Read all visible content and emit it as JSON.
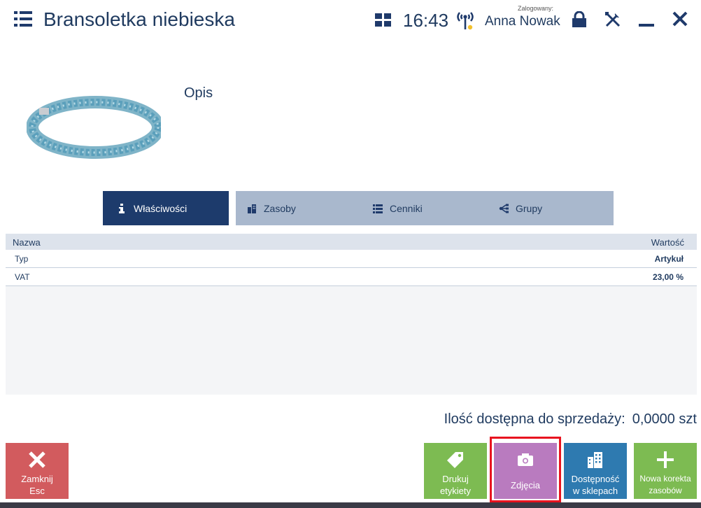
{
  "header": {
    "title": "Bransoletka niebieska",
    "time": "16:43",
    "logged_label": "Zalogowany:",
    "user": "Anna Nowak"
  },
  "product": {
    "description_label": "Opis",
    "image_icon": "bracelet-photo"
  },
  "tabs": [
    {
      "label": "Właściwości",
      "icon": "info-icon",
      "active": true
    },
    {
      "label": "Zasoby",
      "icon": "building-icon",
      "active": false
    },
    {
      "label": "Cenniki",
      "icon": "list-icon",
      "active": false
    },
    {
      "label": "Grupy",
      "icon": "tree-icon",
      "active": false
    }
  ],
  "table": {
    "columns": [
      "Nazwa",
      "Wartość"
    ],
    "rows": [
      {
        "name": "Typ",
        "value": "Artykuł"
      },
      {
        "name": "VAT",
        "value": "23,00 %"
      }
    ]
  },
  "availability": {
    "label": "Ilość dostępna do sprzedaży:",
    "value": "0,0000 szt"
  },
  "actions": {
    "close": {
      "line1": "Zamknij",
      "line2": "Esc",
      "color": "#d25b5e"
    },
    "print": {
      "line1": "Drukuj",
      "line2": "etykiety",
      "color": "#7dbb52"
    },
    "photos": {
      "line1": "Zdjęcia",
      "color": "#b97bbf"
    },
    "availability": {
      "line1": "Dostępność",
      "line2": "w sklepach",
      "color": "#2e7ab0"
    },
    "correction": {
      "line1": "Nowa korekta",
      "line2": "zasobów",
      "color": "#7dbb52"
    }
  },
  "colors": {
    "primary": "#1d3b6c",
    "tab_inactive": "#a9b8cd",
    "highlight": "#e8131f"
  }
}
